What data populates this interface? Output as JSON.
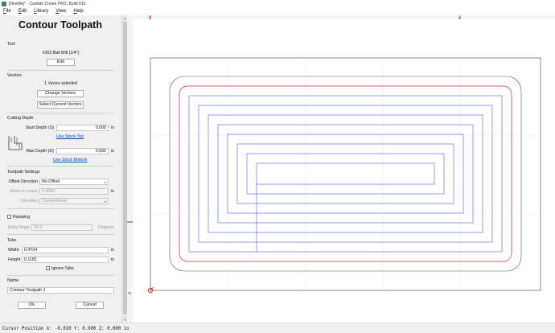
{
  "window": {
    "title": "[Newfile]* - Carbide Create PRO, Build 815"
  },
  "menu": [
    "File",
    "Edit",
    "Library",
    "View",
    "Help"
  ],
  "panel": {
    "title": "Contour Toolpath",
    "tool": {
      "section": "Tool",
      "name": "#202 Ball Mill (1/4\")",
      "edit_label": "Edit"
    },
    "vectors": {
      "section": "Vectors",
      "selected_text": "1 Vector selected",
      "change_label": "Change Vectors",
      "select_current_label": "Select Current Vectors"
    },
    "cutting_depth": {
      "section": "Cutting Depth",
      "start_label": "Start Depth (S)",
      "start_value": "0.000",
      "start_unit": "in",
      "use_stock_top": "Use Stock Top",
      "max_label": "Max Depth (D)",
      "max_value": "0.500",
      "max_unit": "in",
      "use_stock_bottom": "Use Stock Bottom"
    },
    "toolpath_settings": {
      "section": "Toolpath Settings",
      "offset_label": "Offset Direction",
      "offset_value": "No Offset",
      "stock_label": "Stock to Leave",
      "stock_value": "0.0000",
      "stock_unit": "in",
      "direction_label": "Direction",
      "direction_value": "Conventional"
    },
    "ramping": {
      "label": "Ramping",
      "entry_label": "Entry Angle",
      "entry_value": "20.0",
      "entry_unit": "Degrees"
    },
    "tabs": {
      "section": "Tabs",
      "width_label": "Width",
      "width_value": "0.4724",
      "width_unit": "in",
      "height_label": "Height",
      "height_value": "0.1181",
      "height_unit": "in",
      "ignore_label": "Ignore Tabs"
    },
    "name": {
      "section": "Name",
      "value": "Contour Toolpath 1"
    },
    "ok_label": "Ok",
    "cancel_label": "Cancel"
  },
  "ruler": {
    "top_labels": [
      "0",
      "4"
    ],
    "left_labels": [
      "0"
    ]
  },
  "colors": {
    "outline": "#cc2244",
    "toolpath": "#5555ee",
    "grid": "#c8c8c8",
    "stock": "#555555",
    "origin": "#e02020"
  },
  "status": "Cursor Position X: -0.010 Y: 0.900 Z: 0.000 in"
}
